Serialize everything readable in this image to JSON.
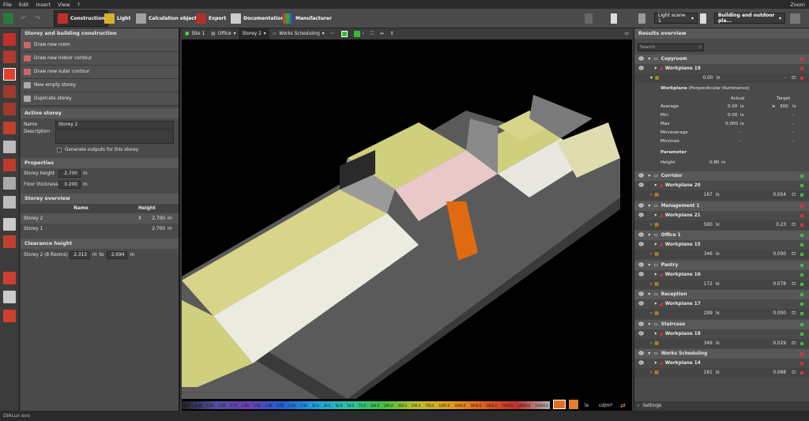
{
  "menu": {
    "file": "File",
    "edit": "Edit",
    "insert": "Insert",
    "view": "View",
    "help": "?",
    "zoom": "Zoom"
  },
  "toolbar": {
    "construction": "Construction",
    "light": "Light",
    "calc": "Calculation objects",
    "export": "Export",
    "documentation": "Documentation",
    "manufacturer": "Manufacturer",
    "light_scene": "Light scene 1",
    "building": "Building and outdoor pla..."
  },
  "left": {
    "section1": "Storey and building construction",
    "btns": [
      "Draw new room",
      "Draw new indoor contour",
      "Draw new outer contour",
      "New empty storey",
      "Duplicate storey"
    ],
    "active_storey": "Active storey",
    "name_label": "Name",
    "name_value": "Storey 2",
    "desc_label": "Description",
    "generate": "Generate outputs for this storey",
    "properties": "Properties",
    "storey_height_label": "Storey height",
    "storey_height": "2.700",
    "thick_label": "Floor thickness",
    "thick": "0.200",
    "unit_m": "m",
    "overview": "Storey overview",
    "col_name": "Name",
    "col_height": "Height",
    "rows": [
      {
        "name": "Storey 2",
        "x": "X",
        "h": "2.700",
        "u": "m"
      },
      {
        "name": "Storey 1",
        "h": "2.700",
        "u": "m"
      }
    ],
    "clearance": "Clearance height",
    "clear_text": "Storey 2 (8 Rooms)",
    "c1": "2.313",
    "c2": "2.694",
    "to": "to"
  },
  "viewport": {
    "site": "Site 1",
    "building": "Office",
    "storey": "Storey 2",
    "room": "Works Scheduling"
  },
  "scale": {
    "values": [
      "0.10",
      "0.20",
      "0.30",
      "0.50",
      "0.75",
      "1.00",
      "1.50",
      "2.00",
      "3.00",
      "5.00",
      "7.50",
      "10.0",
      "20.0",
      "30.0",
      "50.0",
      "75.0",
      "100.0",
      "200.0",
      "300.0",
      "500.0",
      "750.0",
      "1000.0",
      "2000.0",
      "3000.0",
      "5000.0",
      "7500.0",
      "10000.0",
      "15000.0"
    ],
    "unit": "lx",
    "unit2": "cd/m²"
  },
  "right": {
    "title": "Results overview",
    "search": "Search",
    "copyroom": "Copyroom",
    "wp19": "Workplane 19",
    "wp19_val": "0.00",
    "lx": "lx",
    "dash": "-",
    "detail_title": "Workplane",
    "detail_sub": "(Perpendicular illuminance)",
    "actual": "Actual",
    "target": "Target",
    "avg_label": "Average",
    "avg": "0.00",
    "ge": "≥",
    "avg_t": "300",
    "min_label": "Min",
    "min": "0.00",
    "max_label": "Max",
    "max": "0.000",
    "minavg_label": "Min/average",
    "minmax_label": "Min/max",
    "param": "Parameter",
    "height_label": "Height",
    "height": "0.80",
    "m": "m",
    "rooms": [
      {
        "room": "Corridor",
        "wp": "Workplane 20",
        "v": "167",
        "r": "0.054",
        "ok": true
      },
      {
        "room": "Management 1",
        "wp": "Workplane 21",
        "v": "590",
        "r": "0.23",
        "ok": false
      },
      {
        "room": "Office 1",
        "wp": "Workplane 15",
        "v": "346",
        "r": "0.000",
        "ok": true
      },
      {
        "room": "Pantry",
        "wp": "Workplane 16",
        "v": "172",
        "r": "0.078",
        "ok": true
      },
      {
        "room": "Reception",
        "wp": "Workplane 17",
        "v": "299",
        "r": "0.000",
        "ok": true
      },
      {
        "room": "Staircase",
        "wp": "Workplane 18",
        "v": "349",
        "r": "0.029",
        "ok": true
      },
      {
        "room": "Works Scheduling",
        "wp": "Workplane 14",
        "v": "161",
        "r": "0.068",
        "ok": false
      }
    ],
    "settings": "Settings"
  },
  "status": {
    "brand": "DIALux evo"
  }
}
